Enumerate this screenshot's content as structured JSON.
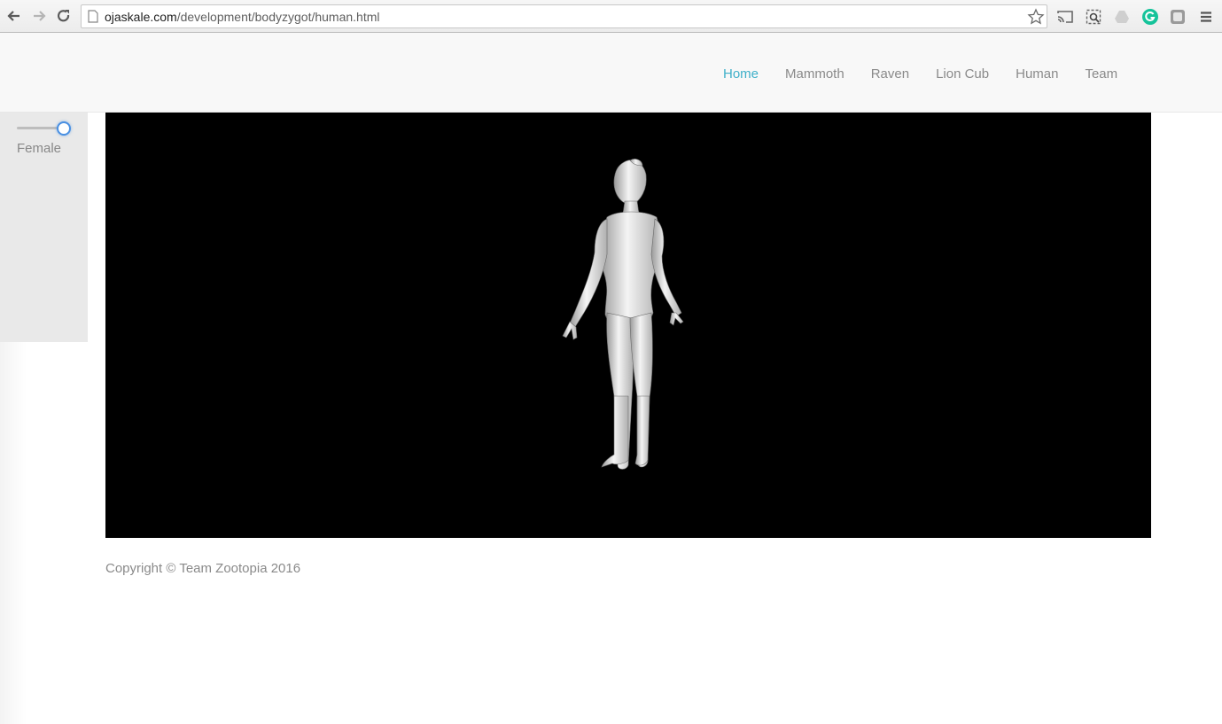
{
  "browser": {
    "url_host": "ojaskale.com",
    "url_path": "/development/bodyzygot/human.html",
    "toolbar_icons": [
      "back-arrow-icon",
      "forward-arrow-icon",
      "reload-icon",
      "page-icon",
      "star-icon",
      "cast-icon",
      "screenshot-icon",
      "drive-icon",
      "grammarly-icon",
      "extension-icon",
      "menu-icon"
    ]
  },
  "nav": {
    "items": [
      {
        "label": "Home",
        "active": true
      },
      {
        "label": "Mammoth",
        "active": false
      },
      {
        "label": "Raven",
        "active": false
      },
      {
        "label": "Lion Cub",
        "active": false
      },
      {
        "label": "Human",
        "active": false
      },
      {
        "label": "Team",
        "active": false
      }
    ],
    "active_color": "#3fb0c9",
    "color": "#8a8a8a"
  },
  "side_panel": {
    "slider_value": 1,
    "label": "Female"
  },
  "viewer": {
    "background": "#000000",
    "model": "female human figure (back view)"
  },
  "footer": {
    "copyright": "Copyright © Team Zootopia 2016"
  }
}
